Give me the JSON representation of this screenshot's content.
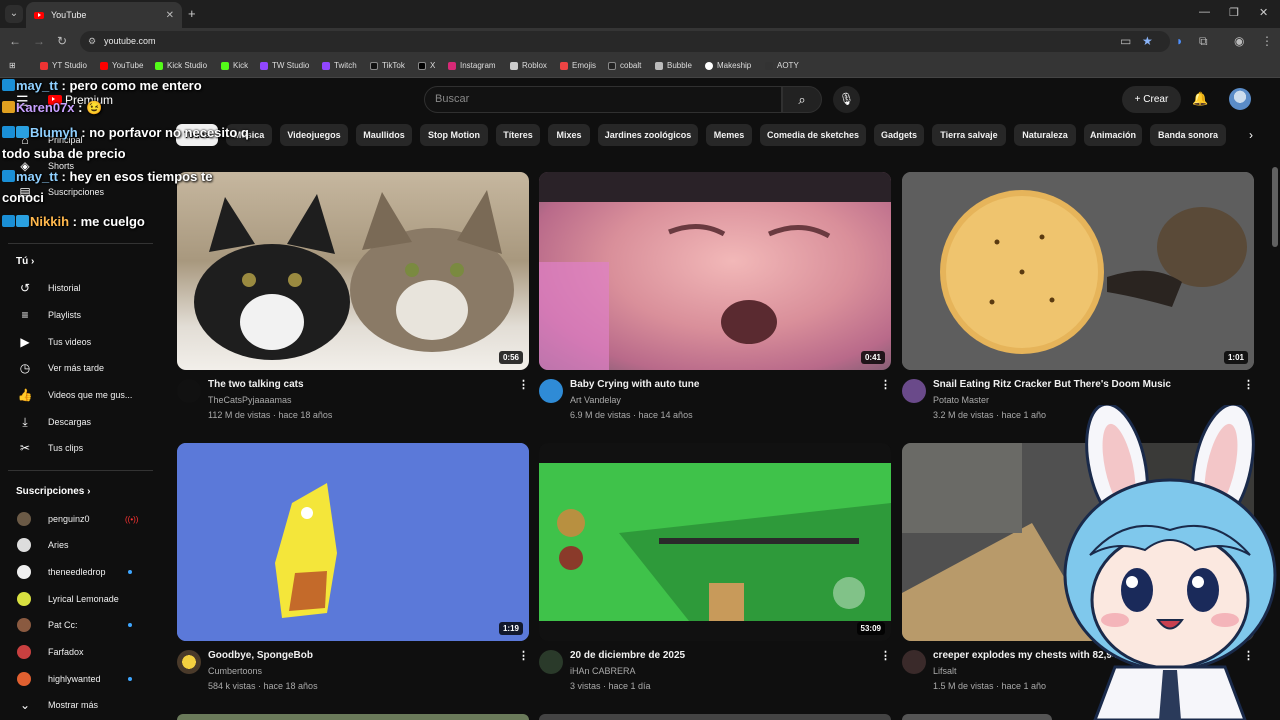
{
  "browser": {
    "tab_title": "YouTube",
    "url": "youtube.com",
    "bookmarks": [
      "YT Studio",
      "YouTube",
      "Kick Studio",
      "Kick",
      "TW Studio",
      "Twitch",
      "TikTok",
      "X",
      "Instagram",
      "Roblox",
      "Emojis",
      "cobalt",
      "Bubble",
      "Makeship",
      "AOTY"
    ]
  },
  "header": {
    "logo": "Premium",
    "search_placeholder": "Buscar",
    "create_label": "Crear"
  },
  "sidebar": {
    "top_items": [
      "Principal",
      "Shorts",
      "Suscripciones"
    ],
    "you_heading": "Tú",
    "you_items": [
      "Historial",
      "Playlists",
      "Tus videos",
      "Ver más tarde",
      "Videos que me gus...",
      "Descargas",
      "Tus clips"
    ],
    "subs_heading": "Suscripciones",
    "subs": [
      "penguinz0",
      "Aries",
      "theneedledrop",
      "Lyrical Lemonade",
      "Pat Cc:",
      "Farfadox",
      "highlywanted"
    ],
    "show_more": "Mostrar más"
  },
  "chips": [
    "Todos",
    "Música",
    "Videojuegos",
    "Maullidos",
    "Stop Motion",
    "Títeres",
    "Mixes",
    "Jardines zoológicos",
    "Memes",
    "Comedia de sketches",
    "Gadgets",
    "Tierra salvaje",
    "Naturaleza",
    "Animación",
    "Banda sonora"
  ],
  "videos": [
    {
      "title": "The two talking cats",
      "channel": "TheCatsPyjaaaamas",
      "meta": "112 M de vistas · hace 18 años",
      "duration": "0:56"
    },
    {
      "title": "Baby Crying with auto tune",
      "channel": "Art Vandelay",
      "meta": "6.9 M de vistas · hace 14 años",
      "duration": "0:41"
    },
    {
      "title": "Snail Eating Ritz Cracker But There's Doom Music",
      "channel": "Potato Master",
      "meta": "3.2 M de vistas · hace 1 año",
      "duration": "1:01"
    },
    {
      "title": "Goodbye, SpongeBob",
      "channel": "Cumbertoons",
      "meta": "584 k vistas · hace 18 años",
      "duration": "1:19"
    },
    {
      "title": "20 de diciembre de 2025",
      "channel": "iHAn CABRERA",
      "meta": "3 vistas · hace 1 día",
      "duration": "53:09"
    },
    {
      "title": "creeper explodes my chests with 82,944 to",
      "channel": "Lifsalt",
      "meta": "1.5 M de vistas · hace 1 año",
      "duration": ""
    }
  ],
  "chat": [
    {
      "user": "may_tt",
      "text": " : pero como me entero"
    },
    {
      "user": "Karen07x",
      "text": " : 😉"
    },
    {
      "user": "Blumyh",
      "text": " : no porfavor no necesito q todo suba de precio"
    },
    {
      "user": "may_tt",
      "text": " : hey en esos tiempos te conoci"
    },
    {
      "user": "Nikkih",
      "text": " : me cuelgo"
    }
  ]
}
